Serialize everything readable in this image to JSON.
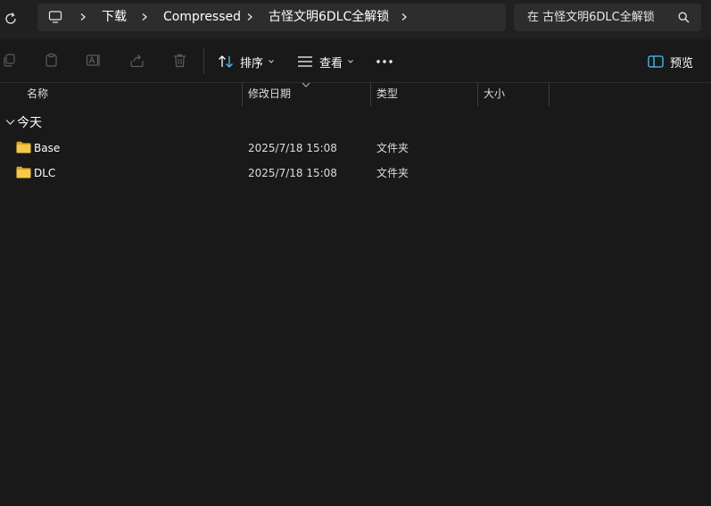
{
  "nav": {
    "breadcrumbs": [
      "下载",
      "Compressed",
      "古怪文明6DLC全解锁"
    ],
    "search_placeholder": "在 古怪文明6DLC全解锁"
  },
  "toolbar": {
    "sort_label": "排序",
    "view_label": "查看",
    "more_label": "•••",
    "preview_label": "预览"
  },
  "columns": {
    "name": "名称",
    "modified": "修改日期",
    "type": "类型",
    "size": "大小"
  },
  "groups": [
    {
      "label": "今天",
      "items": [
        {
          "name": "Base",
          "modified": "2025/7/18 15:08",
          "type": "文件夹"
        },
        {
          "name": "DLC",
          "modified": "2025/7/18 15:08",
          "type": "文件夹"
        }
      ]
    }
  ],
  "colors": {
    "background": "#191919",
    "nav_background": "#202020",
    "address_background": "#2d2d2d",
    "folder": "#f4c84b",
    "accent": "#4cc2ff"
  }
}
